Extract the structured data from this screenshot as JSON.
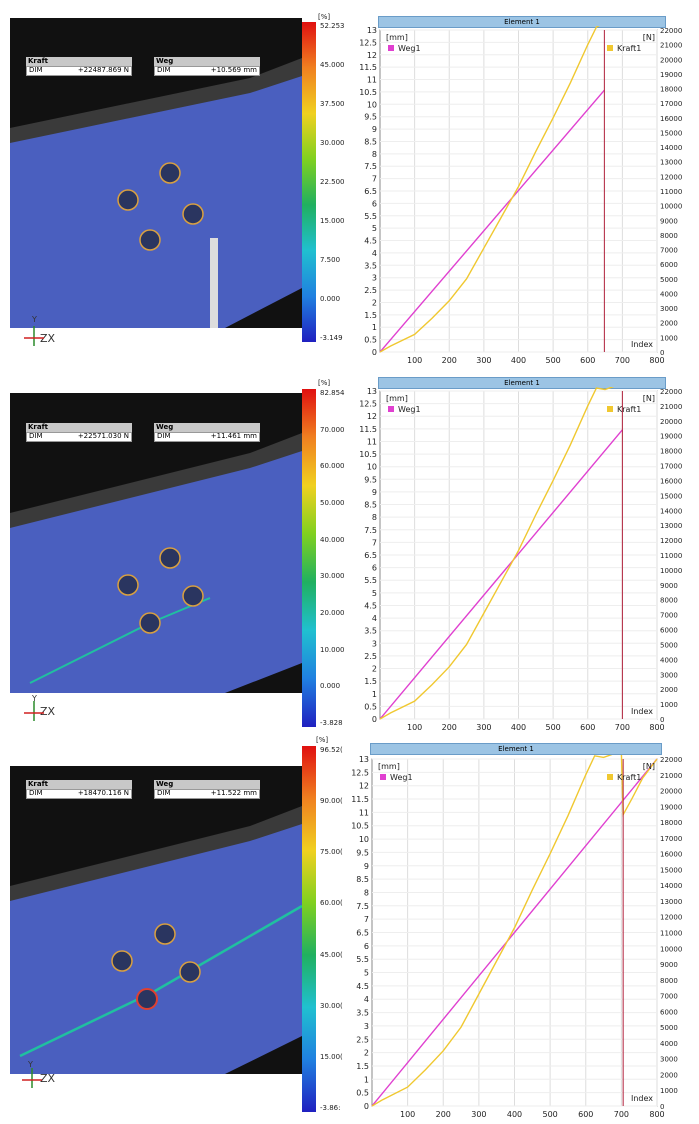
{
  "colors": {
    "weg": "#e040d0",
    "kraft": "#f0c830",
    "cursor": "#b0203a",
    "titlebar": "#9cc4e4",
    "specimen": "#4a5fbf"
  },
  "panels": [
    {
      "kraft_label": "Kraft",
      "kraft_dim": "DIM",
      "kraft_value": "+22487.869 N",
      "weg_label": "Weg",
      "weg_dim": "DIM",
      "weg_value": "+10.569 mm",
      "cbar_unit": "[%]",
      "cbar_ticks": [
        "52.253",
        "45.000",
        "37.500",
        "30.000",
        "22.500",
        "15.000",
        "7.500",
        "0.000",
        "-3.149"
      ],
      "axis_y": "Y",
      "axis_zx": "ZX",
      "chart_title": "Element 1",
      "cursor_index": 648,
      "crack": 0
    },
    {
      "kraft_label": "Kraft",
      "kraft_dim": "DIM",
      "kraft_value": "+22571.030 N",
      "weg_label": "Weg",
      "weg_dim": "DIM",
      "weg_value": "+11.461 mm",
      "cbar_unit": "[%]",
      "cbar_ticks": [
        "82.854",
        "70.000",
        "60.000",
        "50.000",
        "40.000",
        "30.000",
        "20.000",
        "10.000",
        "0.000",
        "-3.828"
      ],
      "axis_y": "Y",
      "axis_zx": "ZX",
      "chart_title": "Element 1",
      "cursor_index": 700,
      "crack": 1
    },
    {
      "kraft_label": "Kraft",
      "kraft_dim": "DIM",
      "kraft_value": "+18470.116 N",
      "weg_label": "Weg",
      "weg_dim": "DIM",
      "weg_value": "+11.522 mm",
      "cbar_unit": "[%]",
      "cbar_ticks": [
        "96.52(",
        "90.00(",
        "75.00(",
        "60.00(",
        "45.00(",
        "30.00(",
        "15.00(",
        "-3.86:"
      ],
      "axis_y": "Y",
      "axis_zx": "ZX",
      "chart_title": "Element 1",
      "cursor_index": 705,
      "crack": 2
    }
  ],
  "chart_data": [
    {
      "type": "line",
      "title": "Element 1",
      "xlabel": "Index",
      "ylabel_left": "[mm]",
      "ylabel_right": "[N]",
      "xlim": [
        0,
        800
      ],
      "ylim_left": [
        0,
        13
      ],
      "ylim_right": [
        0,
        22000
      ],
      "x_ticks": [
        100,
        200,
        300,
        400,
        500,
        600,
        700,
        800
      ],
      "y_ticks_left": [
        0,
        0.5,
        1,
        1.5,
        2,
        2.5,
        3,
        3.5,
        4,
        4.5,
        5,
        5.5,
        6,
        6.5,
        7,
        7.5,
        8,
        8.5,
        9,
        9.5,
        10,
        10.5,
        11,
        11.5,
        12,
        12.5,
        13
      ],
      "y_ticks_right": [
        0,
        1000,
        2000,
        3000,
        4000,
        5000,
        6000,
        7000,
        8000,
        9000,
        10000,
        11000,
        12000,
        13000,
        14000,
        15000,
        16000,
        17000,
        18000,
        19000,
        20000,
        21000,
        22000
      ],
      "grid": true,
      "legend": "top",
      "series": [
        {
          "name": "Weg1",
          "axis": "left",
          "x": [
            0,
            648
          ],
          "y": [
            0,
            10.57
          ]
        },
        {
          "name": "Kraft1",
          "axis": "right",
          "x": [
            0,
            30,
            100,
            150,
            200,
            250,
            300,
            350,
            400,
            450,
            500,
            550,
            600,
            625,
            640,
            648
          ],
          "y": [
            0,
            400,
            1200,
            2300,
            3500,
            5000,
            7100,
            9200,
            11300,
            13700,
            16000,
            18400,
            21000,
            22200,
            22400,
            22488
          ]
        }
      ],
      "cursor": 648
    },
    {
      "type": "line",
      "title": "Element 1",
      "xlabel": "Index",
      "ylabel_left": "[mm]",
      "ylabel_right": "[N]",
      "xlim": [
        0,
        800
      ],
      "ylim_left": [
        0,
        13
      ],
      "ylim_right": [
        0,
        22000
      ],
      "x_ticks": [
        100,
        200,
        300,
        400,
        500,
        600,
        700,
        800
      ],
      "y_ticks_left": [
        0,
        0.5,
        1,
        1.5,
        2,
        2.5,
        3,
        3.5,
        4,
        4.5,
        5,
        5.5,
        6,
        6.5,
        7,
        7.5,
        8,
        8.5,
        9,
        9.5,
        10,
        10.5,
        11,
        11.5,
        12,
        12.5,
        13
      ],
      "y_ticks_right": [
        0,
        1000,
        2000,
        3000,
        4000,
        5000,
        6000,
        7000,
        8000,
        9000,
        10000,
        11000,
        12000,
        13000,
        14000,
        15000,
        16000,
        17000,
        18000,
        19000,
        20000,
        21000,
        22000
      ],
      "grid": true,
      "legend": "top",
      "series": [
        {
          "name": "Weg1",
          "axis": "left",
          "x": [
            0,
            700
          ],
          "y": [
            0,
            11.46
          ]
        },
        {
          "name": "Kraft1",
          "axis": "right",
          "x": [
            0,
            30,
            100,
            150,
            200,
            250,
            300,
            350,
            400,
            450,
            500,
            550,
            600,
            625,
            650,
            675,
            700
          ],
          "y": [
            0,
            400,
            1200,
            2300,
            3500,
            5000,
            7100,
            9200,
            11300,
            13700,
            16000,
            18400,
            21000,
            22200,
            22100,
            22300,
            22571
          ]
        }
      ],
      "cursor": 700
    },
    {
      "type": "line",
      "title": "Element 1",
      "xlabel": "Index",
      "ylabel_left": "[mm]",
      "ylabel_right": "[N]",
      "xlim": [
        0,
        800
      ],
      "ylim_left": [
        0,
        13
      ],
      "ylim_right": [
        0,
        22000
      ],
      "x_ticks": [
        100,
        200,
        300,
        400,
        500,
        600,
        700,
        800
      ],
      "y_ticks_left": [
        0,
        0.5,
        1,
        1.5,
        2,
        2.5,
        3,
        3.5,
        4,
        4.5,
        5,
        5.5,
        6,
        6.5,
        7,
        7.5,
        8,
        8.5,
        9,
        9.5,
        10,
        10.5,
        11,
        11.5,
        12,
        12.5,
        13
      ],
      "y_ticks_right": [
        0,
        1000,
        2000,
        3000,
        4000,
        5000,
        6000,
        7000,
        8000,
        9000,
        10000,
        11000,
        12000,
        13000,
        14000,
        15000,
        16000,
        17000,
        18000,
        19000,
        20000,
        21000,
        22000
      ],
      "grid": true,
      "legend": "top",
      "series": [
        {
          "name": "Weg1",
          "axis": "left",
          "x": [
            0,
            800
          ],
          "y": [
            0,
            13
          ]
        },
        {
          "name": "Kraft1",
          "axis": "right",
          "x": [
            0,
            30,
            100,
            150,
            200,
            250,
            300,
            350,
            400,
            450,
            500,
            550,
            600,
            625,
            650,
            675,
            700,
            705,
            730,
            760,
            800
          ],
          "y": [
            0,
            400,
            1200,
            2300,
            3500,
            5000,
            7100,
            9200,
            11300,
            13700,
            16000,
            18400,
            21000,
            22200,
            22100,
            22300,
            22400,
            18470,
            19500,
            20800,
            22000
          ]
        }
      ],
      "cursor": 705
    }
  ]
}
